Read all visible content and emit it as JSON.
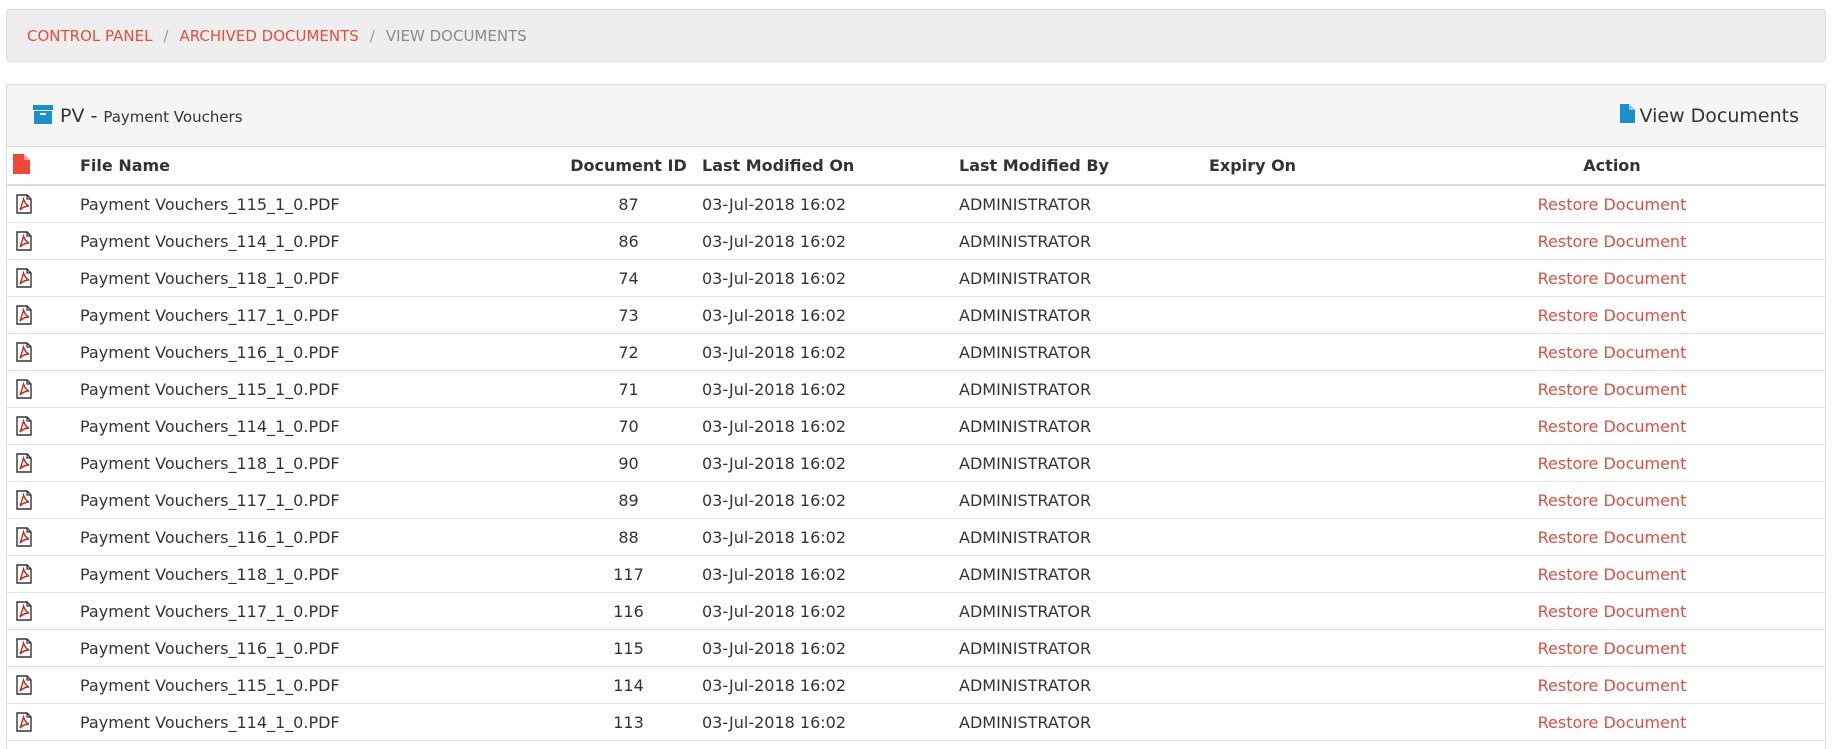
{
  "breadcrumb": {
    "items": [
      "CONTROL PANEL",
      "ARCHIVED DOCUMENTS"
    ],
    "separator": "/",
    "current": "VIEW DOCUMENTS"
  },
  "panel": {
    "code": "PV -",
    "description": "Payment Vouchers",
    "view_documents": "View Documents"
  },
  "colors": {
    "accent_red": "#e84c3d",
    "icon_blue": "#1a8fd0"
  },
  "table": {
    "headers": {
      "file_name": "File Name",
      "document_id": "Document ID",
      "last_modified_on": "Last Modified On",
      "last_modified_by": "Last Modified By",
      "expiry_on": "Expiry On",
      "action": "Action"
    },
    "rows": [
      {
        "file_name": "Payment Vouchers_115_1_0.PDF",
        "document_id": "87",
        "last_modified_on": "03-Jul-2018 16:02",
        "last_modified_by": "ADMINISTRATOR",
        "expiry_on": "",
        "action": "Restore Document"
      },
      {
        "file_name": "Payment Vouchers_114_1_0.PDF",
        "document_id": "86",
        "last_modified_on": "03-Jul-2018 16:02",
        "last_modified_by": "ADMINISTRATOR",
        "expiry_on": "",
        "action": "Restore Document"
      },
      {
        "file_name": "Payment Vouchers_118_1_0.PDF",
        "document_id": "74",
        "last_modified_on": "03-Jul-2018 16:02",
        "last_modified_by": "ADMINISTRATOR",
        "expiry_on": "",
        "action": "Restore Document"
      },
      {
        "file_name": "Payment Vouchers_117_1_0.PDF",
        "document_id": "73",
        "last_modified_on": "03-Jul-2018 16:02",
        "last_modified_by": "ADMINISTRATOR",
        "expiry_on": "",
        "action": "Restore Document"
      },
      {
        "file_name": "Payment Vouchers_116_1_0.PDF",
        "document_id": "72",
        "last_modified_on": "03-Jul-2018 16:02",
        "last_modified_by": "ADMINISTRATOR",
        "expiry_on": "",
        "action": "Restore Document"
      },
      {
        "file_name": "Payment Vouchers_115_1_0.PDF",
        "document_id": "71",
        "last_modified_on": "03-Jul-2018 16:02",
        "last_modified_by": "ADMINISTRATOR",
        "expiry_on": "",
        "action": "Restore Document"
      },
      {
        "file_name": "Payment Vouchers_114_1_0.PDF",
        "document_id": "70",
        "last_modified_on": "03-Jul-2018 16:02",
        "last_modified_by": "ADMINISTRATOR",
        "expiry_on": "",
        "action": "Restore Document"
      },
      {
        "file_name": "Payment Vouchers_118_1_0.PDF",
        "document_id": "90",
        "last_modified_on": "03-Jul-2018 16:02",
        "last_modified_by": "ADMINISTRATOR",
        "expiry_on": "",
        "action": "Restore Document"
      },
      {
        "file_name": "Payment Vouchers_117_1_0.PDF",
        "document_id": "89",
        "last_modified_on": "03-Jul-2018 16:02",
        "last_modified_by": "ADMINISTRATOR",
        "expiry_on": "",
        "action": "Restore Document"
      },
      {
        "file_name": "Payment Vouchers_116_1_0.PDF",
        "document_id": "88",
        "last_modified_on": "03-Jul-2018 16:02",
        "last_modified_by": "ADMINISTRATOR",
        "expiry_on": "",
        "action": "Restore Document"
      },
      {
        "file_name": "Payment Vouchers_118_1_0.PDF",
        "document_id": "117",
        "last_modified_on": "03-Jul-2018 16:02",
        "last_modified_by": "ADMINISTRATOR",
        "expiry_on": "",
        "action": "Restore Document"
      },
      {
        "file_name": "Payment Vouchers_117_1_0.PDF",
        "document_id": "116",
        "last_modified_on": "03-Jul-2018 16:02",
        "last_modified_by": "ADMINISTRATOR",
        "expiry_on": "",
        "action": "Restore Document"
      },
      {
        "file_name": "Payment Vouchers_116_1_0.PDF",
        "document_id": "115",
        "last_modified_on": "03-Jul-2018 16:02",
        "last_modified_by": "ADMINISTRATOR",
        "expiry_on": "",
        "action": "Restore Document"
      },
      {
        "file_name": "Payment Vouchers_115_1_0.PDF",
        "document_id": "114",
        "last_modified_on": "03-Jul-2018 16:02",
        "last_modified_by": "ADMINISTRATOR",
        "expiry_on": "",
        "action": "Restore Document"
      },
      {
        "file_name": "Payment Vouchers_114_1_0.PDF",
        "document_id": "113",
        "last_modified_on": "03-Jul-2018 16:02",
        "last_modified_by": "ADMINISTRATOR",
        "expiry_on": "",
        "action": "Restore Document"
      }
    ]
  }
}
